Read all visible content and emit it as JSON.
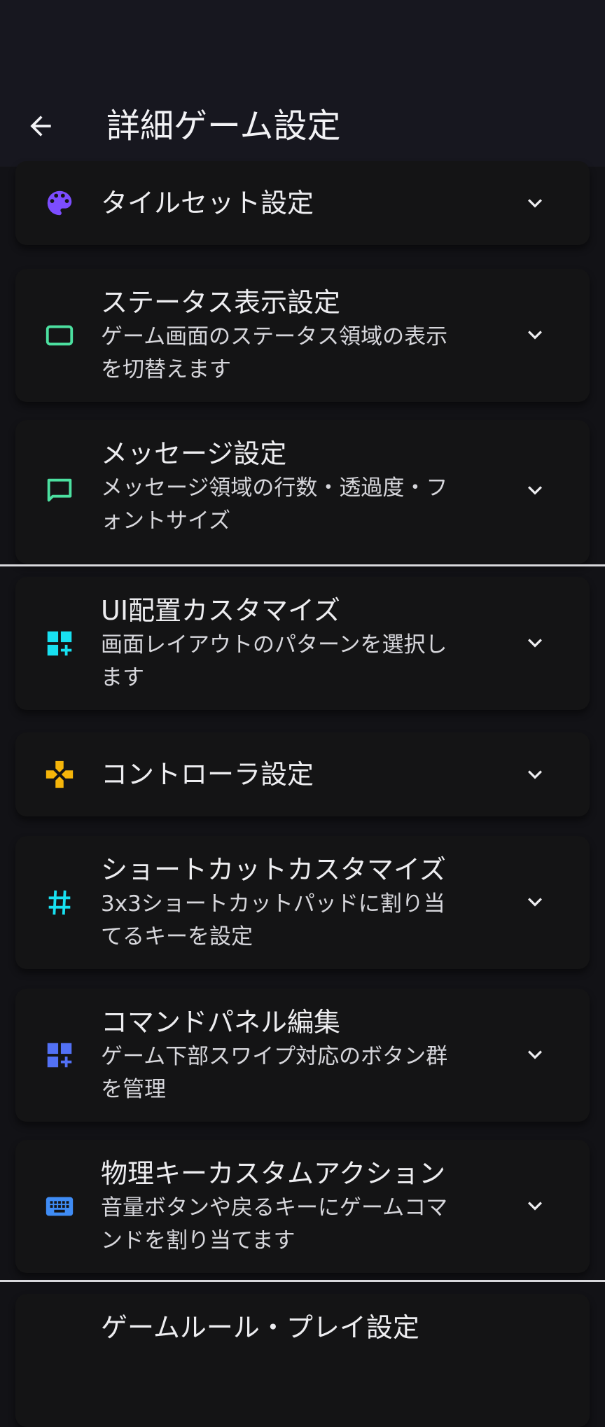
{
  "header": {
    "title": "詳細ゲーム設定"
  },
  "items": [
    {
      "title": "タイルセット設定",
      "sub1": "",
      "sub2": ""
    },
    {
      "title": "ステータス表示設定",
      "sub1": "ゲーム画面のステータス領域の表示",
      "sub2": "を切替えます"
    },
    {
      "title": "メッセージ設定",
      "sub1": "メッセージ領域の行数・透過度・フ",
      "sub2": "ォントサイズ"
    },
    {
      "title": "UI配置カスタマイズ",
      "sub1": "画面レイアウトのパターンを選択し",
      "sub2": "ます"
    },
    {
      "title": "コントローラ設定",
      "sub1": "",
      "sub2": ""
    },
    {
      "title": "ショートカットカスタマイズ",
      "sub1": "3x3ショートカットパッドに割り当",
      "sub2": "てるキーを設定"
    },
    {
      "title": "コマンドパネル編集",
      "sub1": "ゲーム下部スワイプ対応のボタン群",
      "sub2": "を管理"
    },
    {
      "title": "物理キーカスタムアクション",
      "sub1": "音量ボタンや戻るキーにゲームコマ",
      "sub2": "ンドを割り当てます"
    },
    {
      "title": "ゲームルール・プレイ設定",
      "sub1": "",
      "sub2": ""
    }
  ],
  "colors": {
    "palette_icon": "#7C4DFF",
    "status_icon": "#4CE0A0",
    "message_icon": "#4CE0A0",
    "layout_icon": "#18E0F0",
    "controller_icon": "#F5B50A",
    "shortcut_icon": "#18E0F0",
    "command_icon": "#5271F5",
    "keyboard_icon": "#3F8CF5"
  }
}
